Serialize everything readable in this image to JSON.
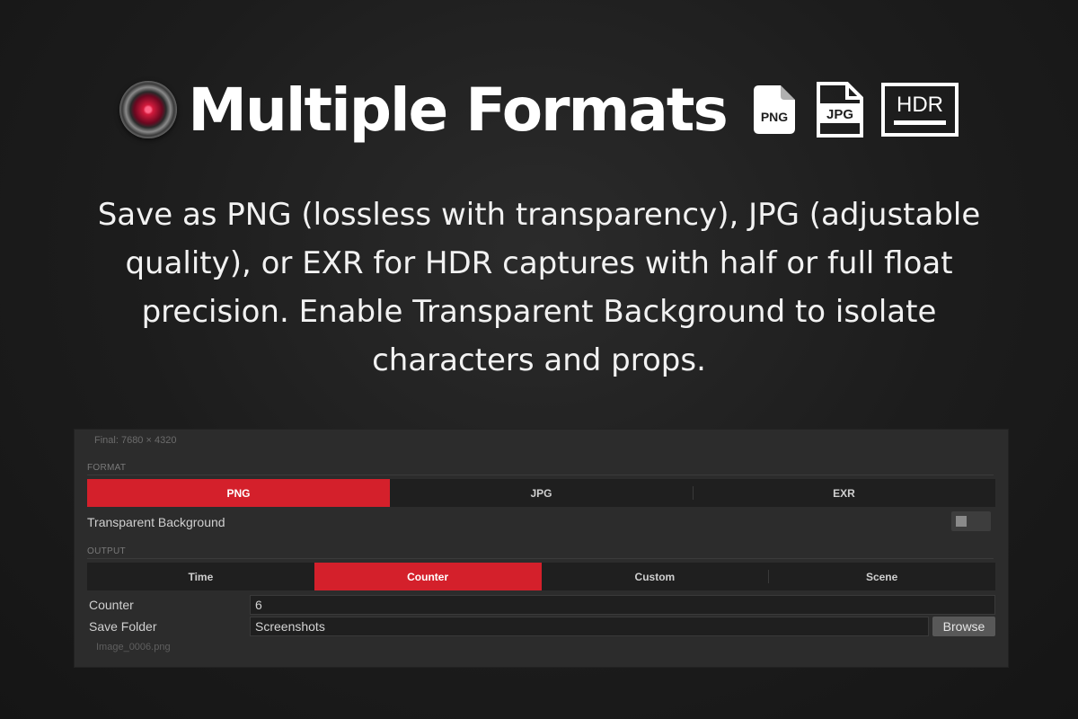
{
  "hero": {
    "title": "Multiple Formats",
    "badges": [
      {
        "icon": "png-file-icon",
        "label": "PNG"
      },
      {
        "icon": "jpg-file-icon",
        "label": "JPG"
      },
      {
        "icon": "hdr-monitor-icon",
        "label": "HDR"
      }
    ],
    "description": "Save as PNG (lossless with transparency), JPG (adjustable quality), or EXR for HDR captures with half or full float precision. Enable Transparent Background to isolate characters and props."
  },
  "panel": {
    "final_resolution": "Final: 7680 × 4320",
    "format": {
      "section_label": "FORMAT",
      "options": [
        "PNG",
        "JPG",
        "EXR"
      ],
      "selected": "PNG"
    },
    "transparent_background": {
      "label": "Transparent Background",
      "enabled": false
    },
    "output": {
      "section_label": "OUTPUT",
      "options": [
        "Time",
        "Counter",
        "Custom",
        "Scene"
      ],
      "selected": "Counter"
    },
    "counter": {
      "label": "Counter",
      "value": "6"
    },
    "save_folder": {
      "label": "Save Folder",
      "value": "Screenshots",
      "browse_label": "Browse"
    },
    "filename_preview": "Image_0006.png"
  },
  "colors": {
    "accent": "#d4202b",
    "panel_bg": "#2c2c2c",
    "field_bg": "#1f1f1f"
  }
}
